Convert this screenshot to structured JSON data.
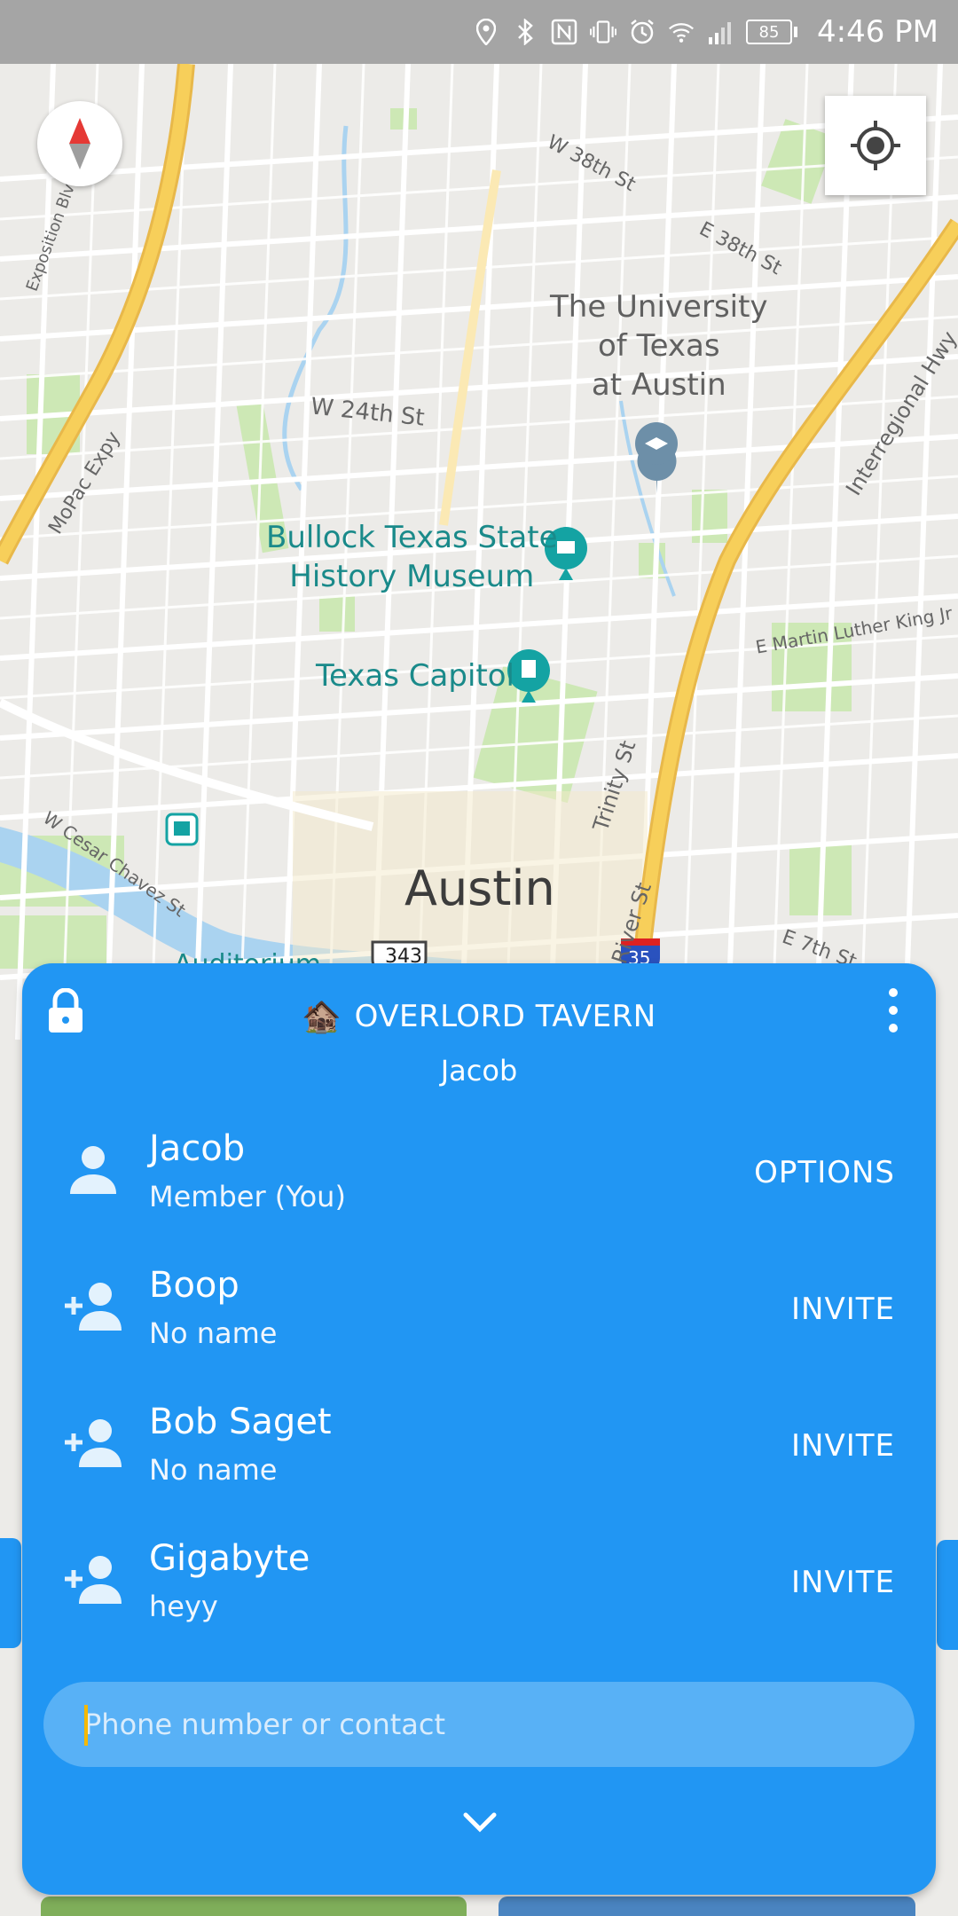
{
  "status_bar": {
    "battery": "85",
    "time": "4:46 PM",
    "icons": [
      "location-icon",
      "bluetooth-icon",
      "nfc-icon",
      "vibrate-icon",
      "alarm-icon",
      "wifi-icon",
      "signal-icon"
    ]
  },
  "map": {
    "labels": {
      "uni": "The University\nof Texas\nat Austin",
      "museum": "Bullock Texas State\nHistory Museum",
      "capitol": "Texas Capitol",
      "city": "Austin",
      "auditorium": "Auditorium",
      "w38": "W 38th St",
      "e38": "E 38th St",
      "w24": "W 24th St",
      "mopac": "MoPac Expy",
      "interregional": "Interregional Hwy",
      "mlk": "E Martin Luther King Jr Blvd",
      "cesar": "W Cesar Chavez St",
      "trinity": "Trinity St",
      "redriver": "Red River St",
      "e7": "E 7th St",
      "hwy343": "343",
      "i35": "35",
      "exposition": "Exposition Blvd"
    }
  },
  "panel": {
    "group_emoji": "🏚️",
    "group_name": "OVERLORD TAVERN",
    "subtitle": "Jacob",
    "members": [
      {
        "name": "Jacob",
        "sub": "Member (You)",
        "action": "OPTIONS"
      },
      {
        "name": "Boop",
        "sub": "No name",
        "action": "INVITE"
      },
      {
        "name": "Bob Saget",
        "sub": "No name",
        "action": "INVITE"
      },
      {
        "name": "Gigabyte",
        "sub": "heyy",
        "action": "INVITE"
      }
    ],
    "input_placeholder": "Phone number or contact"
  },
  "colors": {
    "panel_blue": "#2196f3",
    "input_blue": "#58b1f6",
    "caret": "#f5b800",
    "highway": "#f7cf5a",
    "park": "#cde8b5",
    "water": "#aad3f0"
  }
}
